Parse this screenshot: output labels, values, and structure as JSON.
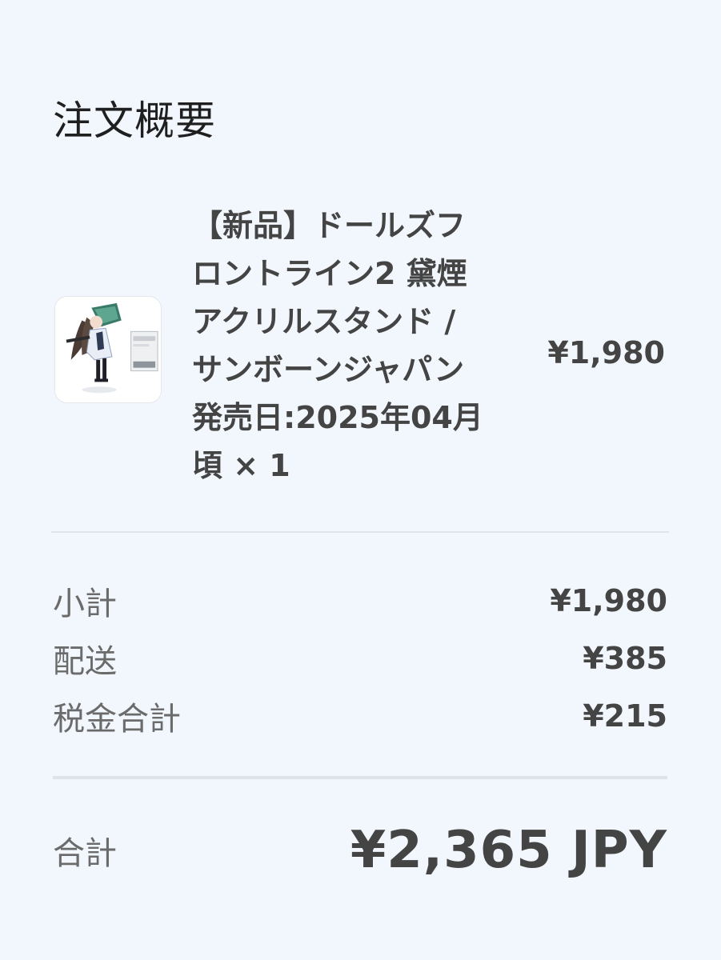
{
  "summary": {
    "title": "注文概要"
  },
  "item": {
    "name": "【新品】ドールズフ\nロントライン2 黛煙\nアクリルスタンド /\nサンボーンジャパン\n発売日:2025年04月\n頃 × 1",
    "price": "¥1,980",
    "thumbnail": "product-image"
  },
  "costs": {
    "subtotal_label": "小計",
    "subtotal_value": "¥1,980",
    "shipping_label": "配送",
    "shipping_value": "¥385",
    "tax_label": "税金合計",
    "tax_value": "¥215"
  },
  "total": {
    "label": "合計",
    "value": "¥2,365 JPY"
  }
}
